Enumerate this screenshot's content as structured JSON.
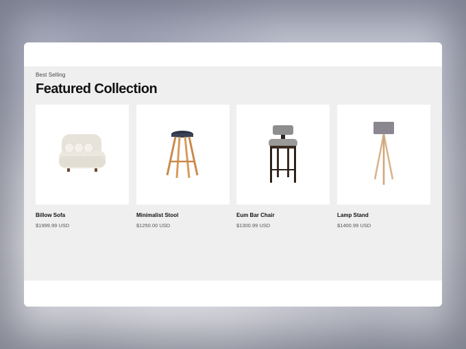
{
  "section": {
    "eyebrow": "Best Selling",
    "title": "Featured Collection"
  },
  "products": [
    {
      "name": "Billow Sofa",
      "price": "$1999.99 USD",
      "image_icon": "sofa-icon"
    },
    {
      "name": "Minimalist Stool",
      "price": "$1250.00 USD",
      "image_icon": "stool-icon"
    },
    {
      "name": "Eum Bar Chair",
      "price": "$1300.99 USD",
      "image_icon": "bar-chair-icon"
    },
    {
      "name": "Lamp Stand",
      "price": "$1400.99 USD",
      "image_icon": "lamp-icon"
    }
  ]
}
